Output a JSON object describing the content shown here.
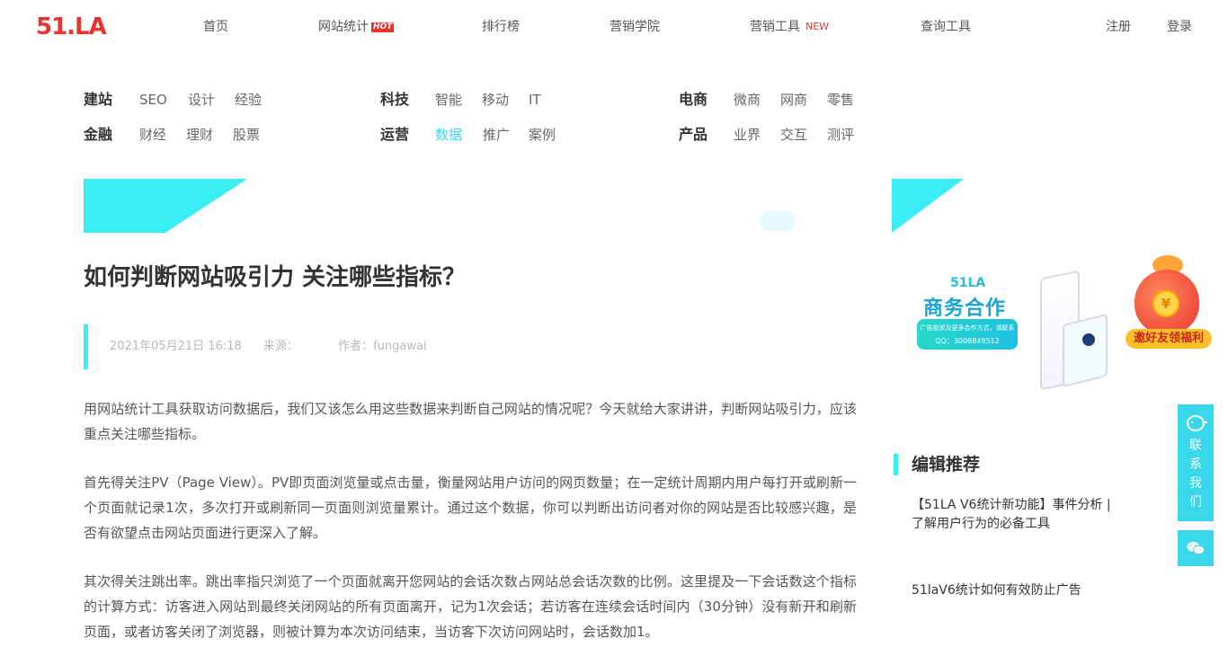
{
  "header": {
    "logo": "51.LA",
    "nav": [
      {
        "label": "首页"
      },
      {
        "label": "网站统计",
        "badge": "HOT"
      },
      {
        "label": "排行榜"
      },
      {
        "label": "营销学院"
      },
      {
        "label": "营销工具",
        "badge": "NEW"
      },
      {
        "label": "查询工具"
      }
    ],
    "register": "注册",
    "login": "登录"
  },
  "categories": [
    {
      "head": "建站",
      "links": [
        "SEO",
        "设计",
        "经验"
      ]
    },
    {
      "head": "科技",
      "links": [
        "智能",
        "移动",
        "IT"
      ]
    },
    {
      "head": "电商",
      "links": [
        "微商",
        "网商",
        "零售"
      ]
    },
    {
      "head": "金融",
      "links": [
        "财经",
        "理财",
        "股票"
      ]
    },
    {
      "head": "运营",
      "links": [
        "数据",
        "推广",
        "案例"
      ],
      "active": "数据"
    },
    {
      "head": "产品",
      "links": [
        "业界",
        "交互",
        "测评"
      ]
    }
  ],
  "article": {
    "title": "如何判断网站吸引力 关注哪些指标？",
    "date": "2021年05月21日 16:18",
    "source": "来源：",
    "author": "作者：fungawai",
    "paragraphs": [
      "用网站统计工具获取访问数据后，我们又该怎么用这些数据来判断自己网站的情况呢？今天就给大家讲讲，判断网站吸引力，应该重点关注哪些指标。",
      "首先得关注PV（Page View）。PV即页面浏览量或点击量，衡量网站用户访问的网页数量；在一定统计周期内用户每打开或刷新一个页面就记录1次，多次打开或刷新同一页面则浏览量累计。通过这个数据，你可以判断出访问者对你的网站是否比较感兴趣，是否有欲望点击网站页面进行更深入了解。",
      "其次得关注跳出率。跳出率指只浏览了一个页面就离开您网站的会话次数占网站总会话次数的比例。这里提及一下会话数这个指标的计算方式：访客进入网站到最终关闭网站的所有页面离开，记为1次会话；若访客在连续会话时间内（30分钟）没有新开和刷新页面，或者访客关闭了浏览器，则被计算为本次访问结束，当访客下次访问网站时，会话数加1。"
    ]
  },
  "sidebar": {
    "ad": {
      "brand": "51LA",
      "title": "商务合作",
      "pill_line1": "广告投放及更多合作方式，请联系",
      "pill_line2": "QQ：3008849512"
    },
    "gift": {
      "coin": "¥",
      "label": "邀好友领福利"
    },
    "recommend_title": "编辑推荐",
    "recommend": [
      "【51LA V6统计新功能】事件分析 | 了解用户行为的必备工具",
      "51laV6统计如何有效防止广告"
    ]
  },
  "float": {
    "contact": [
      "联",
      "系",
      "我",
      "们"
    ]
  },
  "colors": {
    "brand_red": "#e8342f",
    "accent_cyan": "#38eef2",
    "float_cyan": "#38d7ea"
  }
}
